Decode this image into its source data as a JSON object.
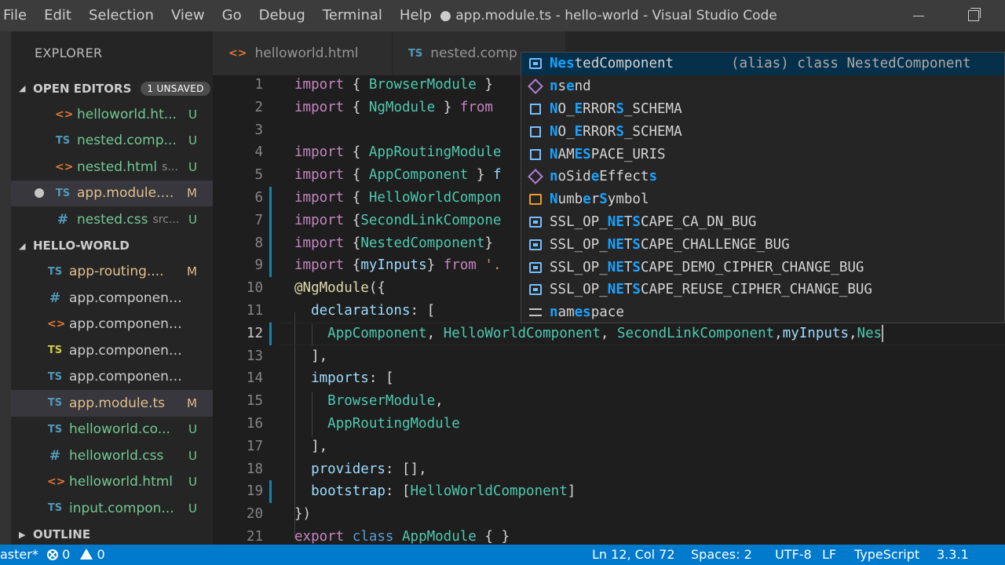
{
  "menubar": [
    "File",
    "Edit",
    "Selection",
    "View",
    "Go",
    "Debug",
    "Terminal",
    "Help"
  ],
  "window_title": "● app.module.ts - hello-world - Visual Studio Code",
  "sidebar": {
    "title": "EXPLORER",
    "open_editors": {
      "label": "OPEN EDITORS",
      "badge": "1 UNSAVED",
      "files": [
        {
          "icon": "<>",
          "name": "helloworld.ht...",
          "status": "U"
        },
        {
          "icon": "TS",
          "name": "nested.comp...",
          "status": "U"
        },
        {
          "icon": "<>",
          "name": "nested.html",
          "desc": "s...",
          "status": "U"
        },
        {
          "icon": "TS",
          "name": "app.module.t...",
          "status": "M"
        },
        {
          "icon": "#",
          "name": "nested.css",
          "desc": "src...",
          "status": "U"
        }
      ]
    },
    "project": {
      "label": "HELLO-WORLD",
      "files": [
        {
          "icon": "TS",
          "name": "app-routing....",
          "status": "M"
        },
        {
          "icon": "#",
          "name": "app.component.css",
          "status": ""
        },
        {
          "icon": "<>",
          "name": "app.component.html",
          "status": ""
        },
        {
          "icon": "TS",
          "name": "app.component.sp...",
          "status": ""
        },
        {
          "icon": "TS",
          "name": "app.component.ts",
          "status": ""
        },
        {
          "icon": "TS",
          "name": "app.module.ts",
          "status": "M"
        },
        {
          "icon": "TS",
          "name": "helloworld.co...",
          "status": "U"
        },
        {
          "icon": "#",
          "name": "helloworld.css",
          "status": "U"
        },
        {
          "icon": "<>",
          "name": "helloworld.html",
          "status": "U"
        },
        {
          "icon": "TS",
          "name": "input.compon...",
          "status": "U"
        }
      ]
    },
    "outline_label": "OUTLINE"
  },
  "tabs": [
    {
      "icon": "<>",
      "label": "helloworld.html"
    },
    {
      "icon": "TS",
      "label": "nested.comp"
    }
  ],
  "editor": {
    "lines": [
      {
        "n": "1",
        "text": "import { BrowserModule }"
      },
      {
        "n": "2",
        "text": "import { NgModule } from"
      },
      {
        "n": "3",
        "text": ""
      },
      {
        "n": "4",
        "text": "import { AppRoutingModule"
      },
      {
        "n": "5",
        "text": "import { AppComponent } f"
      },
      {
        "n": "6",
        "text": "import { HelloWorldCompon"
      },
      {
        "n": "7",
        "text": "import {SecondLinkCompone"
      },
      {
        "n": "8",
        "text": "import {NestedComponent}"
      },
      {
        "n": "9",
        "text": "import {myInputs} from '."
      },
      {
        "n": "10",
        "text": "@NgModule({"
      },
      {
        "n": "11",
        "text": "  declarations: ["
      },
      {
        "n": "12",
        "text": "    AppComponent, HelloWorldComponent, SecondLinkComponent,myInputs,Nes"
      },
      {
        "n": "13",
        "text": "  ],"
      },
      {
        "n": "14",
        "text": "  imports: ["
      },
      {
        "n": "15",
        "text": "    BrowserModule,"
      },
      {
        "n": "16",
        "text": "    AppRoutingModule"
      },
      {
        "n": "17",
        "text": "  ],"
      },
      {
        "n": "18",
        "text": "  providers: [],"
      },
      {
        "n": "19",
        "text": "  bootstrap: [HelloWorldComponent]"
      },
      {
        "n": "20",
        "text": "})"
      },
      {
        "n": "21",
        "text": "export class AppModule { }"
      }
    ]
  },
  "suggest": {
    "detail": "(alias) class NestedComponent",
    "items": [
      {
        "icon": "variable",
        "label": "NestedComponent"
      },
      {
        "icon": "cube",
        "label": "nsend"
      },
      {
        "icon": "field",
        "label": "NO_ERRORS_SCHEMA"
      },
      {
        "icon": "field",
        "label": "NO_ERRORS_SCHEMA"
      },
      {
        "icon": "field",
        "label": "NAMESPACE_URIS"
      },
      {
        "icon": "cube",
        "label": "noSideEffects"
      },
      {
        "icon": "enum",
        "label": "NumberSymbol"
      },
      {
        "icon": "variable",
        "label": "SSL_OP_NETSCAPE_CA_DN_BUG"
      },
      {
        "icon": "variable",
        "label": "SSL_OP_NETSCAPE_CHALLENGE_BUG"
      },
      {
        "icon": "variable",
        "label": "SSL_OP_NETSCAPE_DEMO_CIPHER_CHANGE_BUG"
      },
      {
        "icon": "variable",
        "label": "SSL_OP_NETSCAPE_REUSE_CIPHER_CHANGE_BUG"
      },
      {
        "icon": "namespace",
        "label": "namespace"
      }
    ]
  },
  "statusbar": {
    "branch": "aster*",
    "errors": "0",
    "warnings": "0",
    "position": "Ln 12, Col 72",
    "spaces": "Spaces: 2",
    "encoding": "UTF-8",
    "eol": "LF",
    "language": "TypeScript",
    "version": "3.3.1"
  },
  "colors": {
    "statusbar": "#007acc",
    "untracked": "#73c991",
    "modified": "#e2c08d",
    "suggest_highlight": "#18a3ff"
  }
}
